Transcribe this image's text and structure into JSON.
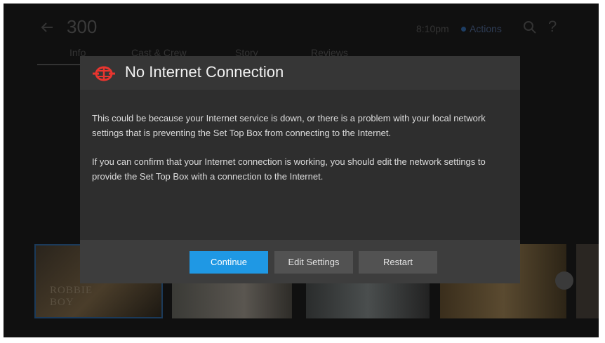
{
  "background": {
    "title": "300",
    "clock": "8:10pm",
    "status": "Actions",
    "tabs": [
      "Info",
      "Cast & Crew",
      "Story",
      "Reviews"
    ],
    "posters": [
      {
        "title": "ROBBIE\nBOY"
      }
    ]
  },
  "dialog": {
    "title": "No Internet Connection",
    "icon": "disconnected-globe-icon",
    "paragraphs": [
      "This could be because your Internet service is down, or there is a problem with your local network settings that is preventing the Set Top Box from connecting to the Internet.",
      "If you can confirm that your Internet connection is working, you should edit the network settings to provide the Set Top Box with a connection to the Internet."
    ],
    "buttons": {
      "continue": "Continue",
      "edit_settings": "Edit Settings",
      "restart": "Restart"
    }
  },
  "colors": {
    "accent": "#1f98e4",
    "icon_red": "#e8352f",
    "dialog_bg": "#2e2e2e"
  }
}
